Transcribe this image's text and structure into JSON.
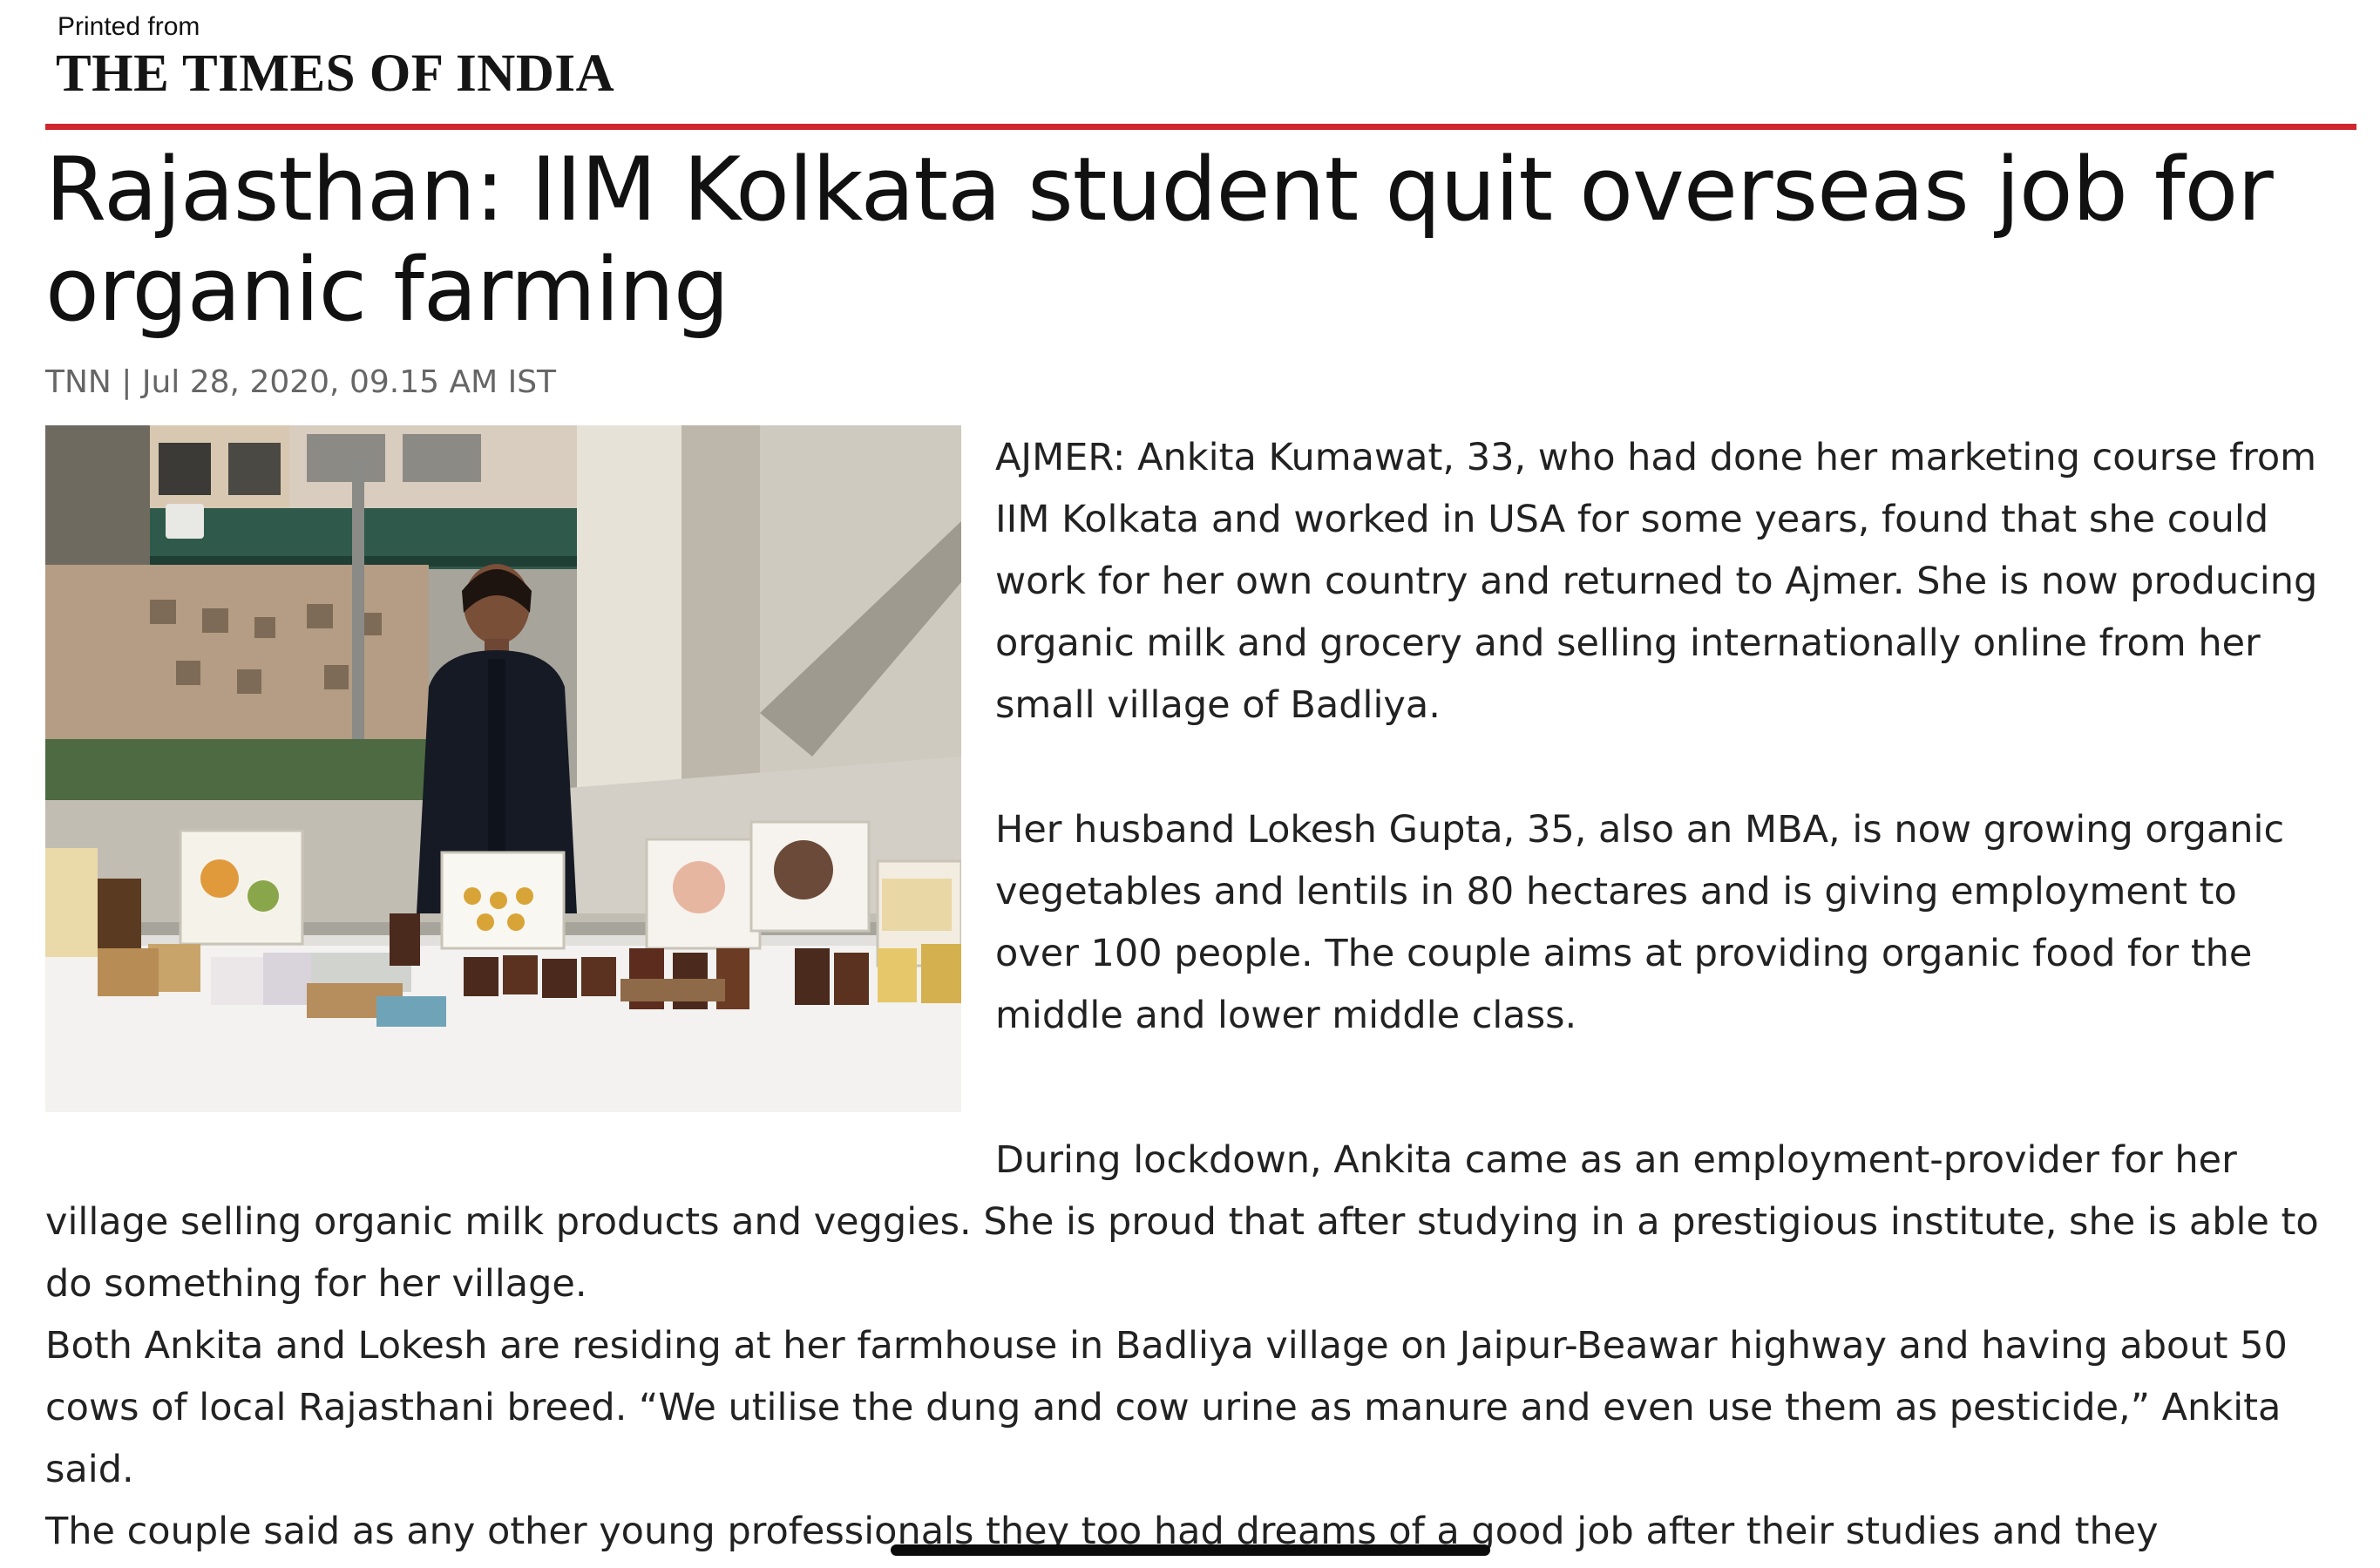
{
  "header": {
    "printed_from": "Printed from",
    "publication": "THE TIMES OF INDIA"
  },
  "article": {
    "headline": "Rajasthan: IIM Kolkata student quit overseas job for organic farming",
    "byline": "TNN | Jul 28, 2020, 09.15 AM IST",
    "paragraphs": [
      "AJMER: Ankita Kumawat, 33, who had done her marketing course from IIM Kolkata and worked in USA for some years, found that she could work for her own country and returned to Ajmer. She is now producing organic milk and grocery and selling internationally online from her small village of Badliya.",
      "Her husband Lokesh Gupta, 35, also an MBA, is now growing organic vegetables and lentils in 80 hectares and is giving employment to over 100 people. The couple aims at providing organic food for the middle and lower middle class.",
      "During lockdown, Ankita came as an employment-provider for her village selling organic milk products and veggies. She is proud that after studying in a prestigious institute, she is able to do something for her village.",
      "Both Ankita and Lokesh are residing at her farmhouse in Badliya village on Jaipur-Beawar highway and having about 50 cows of local Rajasthani breed. “We utilise the dung and cow urine as manure and even use them as pesticide,” Ankita said.",
      "The couple said as any other young professionals they too had dreams of a good job after their studies and they"
    ]
  },
  "colors": {
    "rule": "#d0262d",
    "byline": "#666666",
    "body_text": "#222222"
  },
  "icons": {
    "photo": "article-photo",
    "home_indicator": "home-indicator-bar"
  }
}
